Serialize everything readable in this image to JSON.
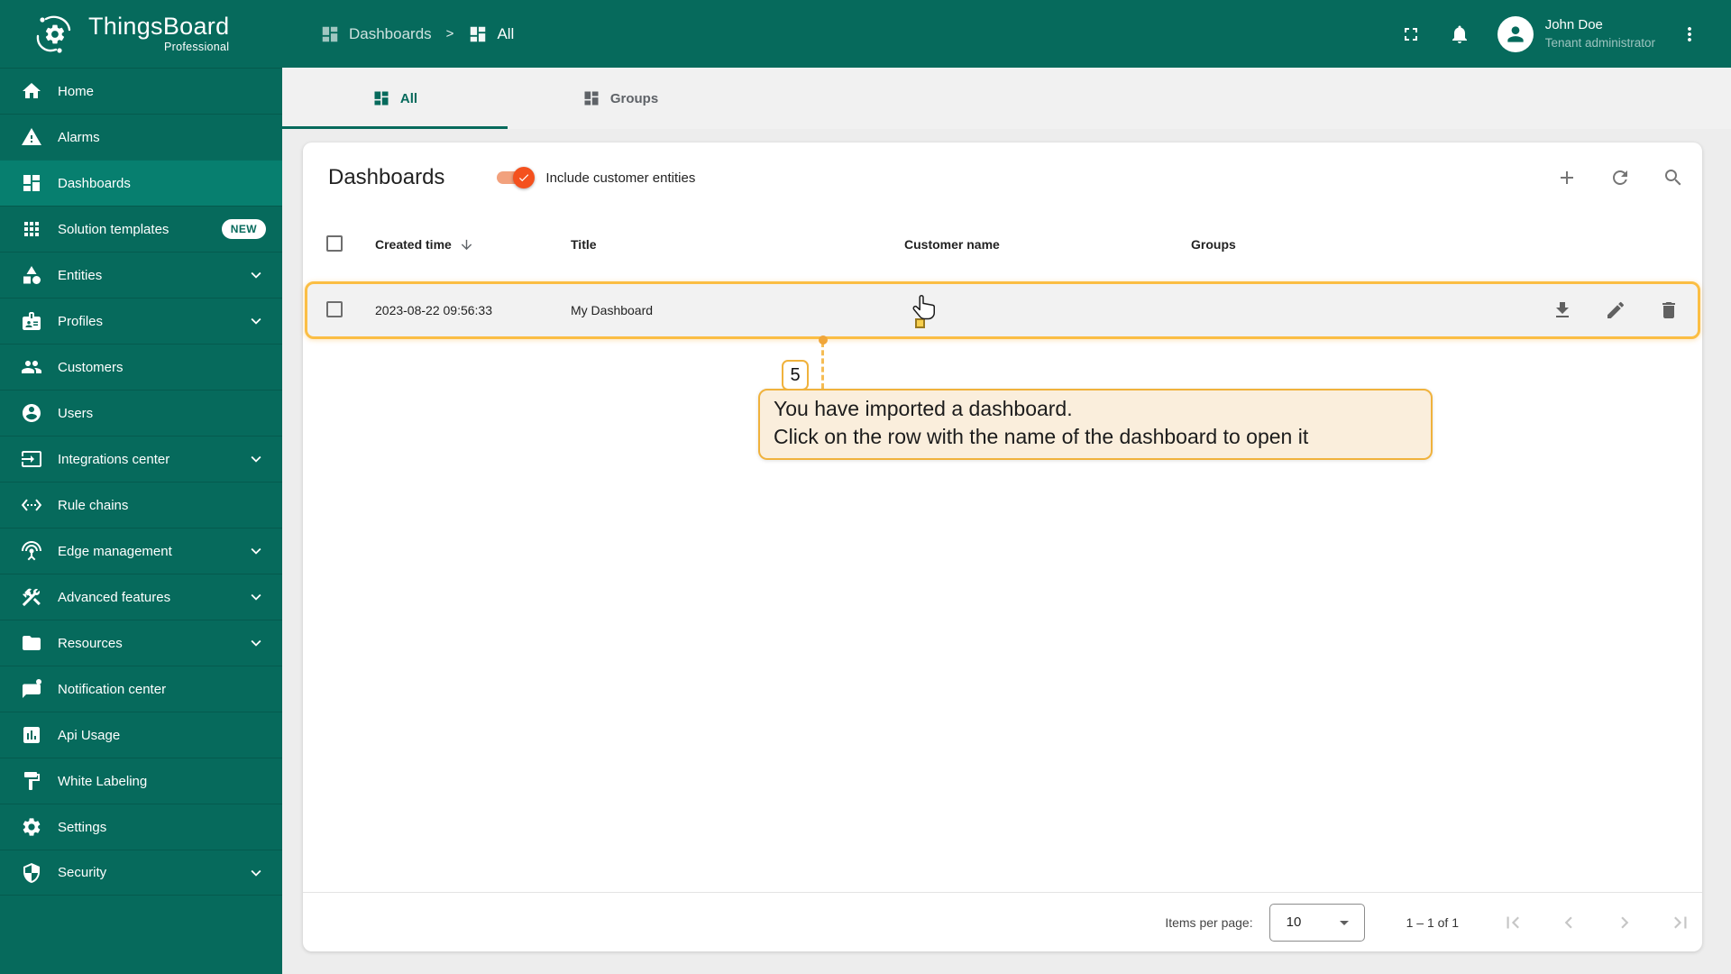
{
  "app": {
    "brand": "ThingsBoard",
    "edition": "Professional"
  },
  "header": {
    "breadcrumb": [
      {
        "label": "Dashboards",
        "icon": "dashboards"
      },
      {
        "label": "All",
        "icon": "dashboards"
      }
    ],
    "icons": [
      "fullscreen",
      "notifications",
      "more-vert"
    ],
    "user": {
      "name": "John Doe",
      "role": "Tenant administrator"
    }
  },
  "sidebar": {
    "items": [
      {
        "label": "Home",
        "icon": "home"
      },
      {
        "label": "Alarms",
        "icon": "alarms"
      },
      {
        "label": "Dashboards",
        "icon": "dashboards",
        "active": true
      },
      {
        "label": "Solution templates",
        "icon": "solution-templates",
        "badge": "NEW"
      },
      {
        "label": "Entities",
        "icon": "entities",
        "expandable": true
      },
      {
        "label": "Profiles",
        "icon": "profiles",
        "expandable": true
      },
      {
        "label": "Customers",
        "icon": "customers"
      },
      {
        "label": "Users",
        "icon": "users"
      },
      {
        "label": "Integrations center",
        "icon": "integrations-center",
        "expandable": true
      },
      {
        "label": "Rule chains",
        "icon": "rule-chains"
      },
      {
        "label": "Edge management",
        "icon": "edge-management",
        "expandable": true
      },
      {
        "label": "Advanced features",
        "icon": "advanced-features",
        "expandable": true
      },
      {
        "label": "Resources",
        "icon": "resources",
        "expandable": true
      },
      {
        "label": "Notification center",
        "icon": "notification-center"
      },
      {
        "label": "Api Usage",
        "icon": "api-usage"
      },
      {
        "label": "White Labeling",
        "icon": "white-labeling"
      },
      {
        "label": "Settings",
        "icon": "settings"
      },
      {
        "label": "Security",
        "icon": "security",
        "expandable": true
      }
    ]
  },
  "tabs": [
    {
      "label": "All",
      "active": true
    },
    {
      "label": "Groups",
      "active": false
    }
  ],
  "content": {
    "title": "Dashboards",
    "toggle_label": "Include customer entities",
    "toggle_checked": true,
    "toolbar_icons": [
      "add",
      "refresh",
      "search"
    ],
    "table": {
      "columns": [
        "Created time",
        "Title",
        "Customer name",
        "Groups"
      ],
      "sorted_by": "Created time",
      "sort_direction": "desc",
      "rows": [
        {
          "created_time": "2023-08-22 09:56:33",
          "title": "My Dashboard",
          "customer_name": "",
          "groups": ""
        }
      ]
    },
    "row_actions": [
      "download",
      "edit",
      "delete"
    ]
  },
  "tutorial": {
    "step": "5",
    "line1": "You have imported a dashboard.",
    "line2": "Click on the row with the name of the dashboard to open it"
  },
  "pagination": {
    "items_per_page_label": "Items per page:",
    "page_size": "10",
    "range": "1 – 1 of 1"
  },
  "colors": {
    "primary_teal": "#066A5C",
    "active_item_teal": "#077F6F",
    "accent_orange": "#F4511E",
    "toggle_track_orange": "#F2A17D",
    "row_highlight_gold": "#FBBE44",
    "tooltip_border_gold": "#F0B23C",
    "tooltip_background": "#FAEEDC",
    "content_background": "#EDEDED",
    "tabbar_background": "#F1F1F1"
  }
}
